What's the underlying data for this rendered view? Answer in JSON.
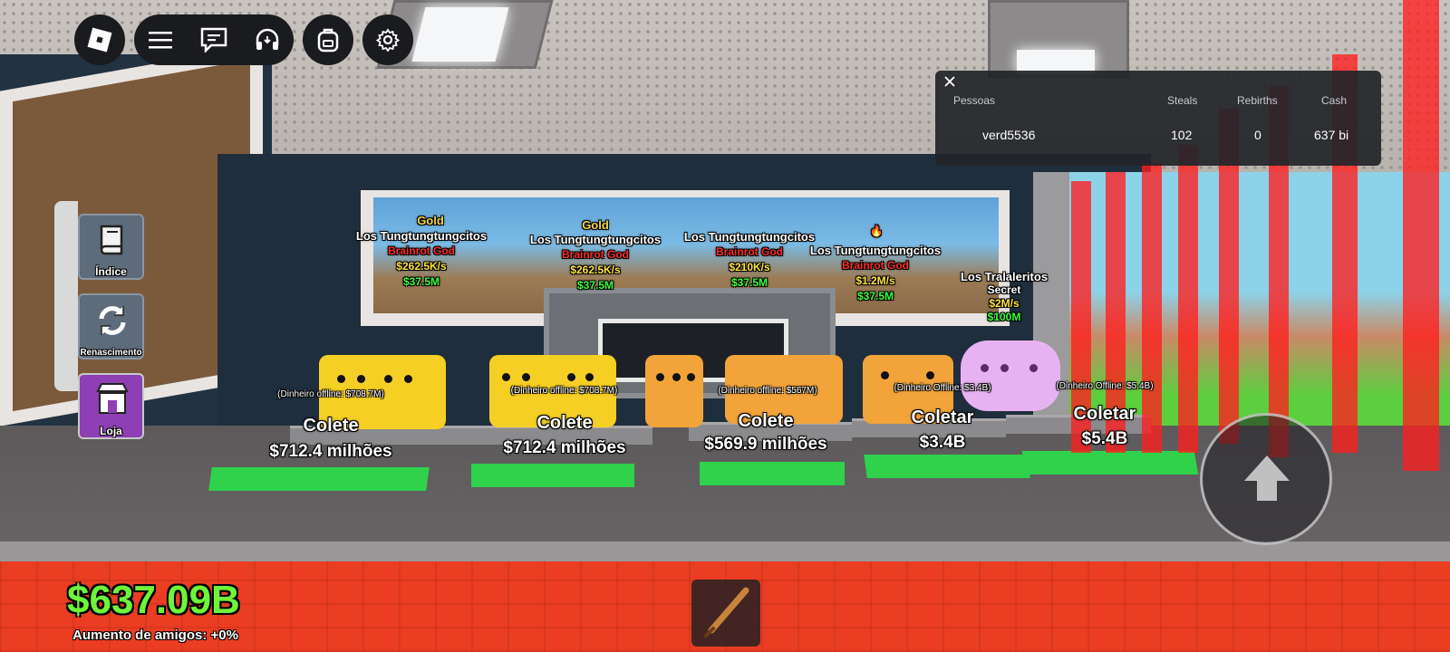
{
  "hud": {
    "buttons": [
      {
        "icon": "roblox-logo-icon"
      },
      {
        "icon": "menu-icon"
      },
      {
        "icon": "chat-icon"
      },
      {
        "icon": "voice-headset-icon"
      },
      {
        "icon": "backpack-icon"
      },
      {
        "icon": "settings-icon"
      }
    ]
  },
  "leaderboard": {
    "headers": {
      "player": "Pessoas",
      "steals": "Steals",
      "rebirths": "Rebirths",
      "cash": "Cash"
    },
    "rows": [
      {
        "player": "verd5536",
        "steals": "102",
        "rebirths": "0",
        "cash": "637 bi"
      }
    ]
  },
  "side_menu": {
    "index_label": "Índice",
    "rebirth_label": "Renascimento",
    "shop_label": "Loja"
  },
  "brainrots": [
    {
      "tier": "Gold",
      "name": "Los Tungtungtungcitos",
      "mutation": "Brainrot God",
      "rate": "$262.5K/s",
      "price": "$37.5M"
    },
    {
      "tier": "Gold",
      "name": "Los Tungtungtungcitos",
      "mutation": "Brainrot God",
      "rate": "$262.5K/s",
      "price": "$37.5M"
    },
    {
      "tier": "",
      "name": "Los Tungtungtungcitos",
      "mutation": "Brainrot God",
      "rate": "$210K/s",
      "price": "$37.5M"
    },
    {
      "tier": "",
      "name": "Los Tungtungtungcitos",
      "mutation": "Brainrot God",
      "rate": "$1.2M/s",
      "price": "$37.5M"
    },
    {
      "tier": "",
      "name": "Los Tralaleritos",
      "mutation": "Secret",
      "rate": "$2M/s",
      "price": "$100M"
    }
  ],
  "collectors": [
    {
      "offline": "(Dinheiro offline: $708.7M)",
      "action": "Colete",
      "amount": "$712.4 milhões"
    },
    {
      "offline": "(Dinheiro offline: $708.7M)",
      "action": "Colete",
      "amount": "$712.4 milhões"
    },
    {
      "offline": "(Dinheiro offline: $567M)",
      "action": "Colete",
      "amount": "$569.9 milhões"
    },
    {
      "offline": "(Dinheiro Offline: $3.4B)",
      "action": "Coletar",
      "amount": "$3.4B"
    },
    {
      "offline": "(Dinheiro Offline: $5.4B)",
      "action": "Coletar",
      "amount": "$5.4B"
    }
  ],
  "player_money": "$637.09B",
  "friends_boost": "Aumento de amigos: +0%",
  "hotbar": {
    "slot1": "bat"
  },
  "controls": {
    "jump": "jump-arrow-icon"
  },
  "colors": {
    "money": "#6ef53a",
    "pad": "#2fd24a",
    "floor": "#ea3d22"
  }
}
